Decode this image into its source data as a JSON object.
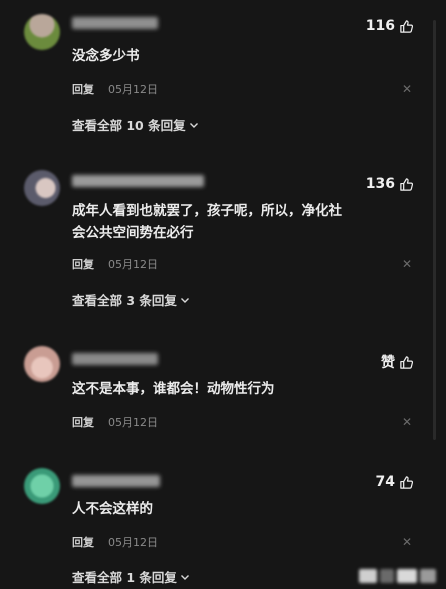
{
  "comments": [
    {
      "likes": "116",
      "text": "没念多少书",
      "reply_label": "回复",
      "date": "05月12日",
      "view_all": "查看全部 10 条回复"
    },
    {
      "likes": "136",
      "text": "成年人看到也就罢了，孩子呢，所以，净化社会公共空间势在必行",
      "reply_label": "回复",
      "date": "05月12日",
      "view_all": "查看全部 3 条回复"
    },
    {
      "likes": "赞",
      "text": "这不是本事，谁都会！动物性行为",
      "reply_label": "回复",
      "date": "05月12日"
    },
    {
      "likes": "74",
      "text": "人不会这样的",
      "reply_label": "回复",
      "date": "05月12日",
      "view_all": "查看全部 1 条回复"
    }
  ],
  "icons": {
    "like": "thumbs-up-icon",
    "close": "close-icon",
    "expand": "chevron-down-icon"
  },
  "colors": {
    "background": "#161616",
    "text": "#ececec",
    "muted": "#8a8a8a"
  }
}
